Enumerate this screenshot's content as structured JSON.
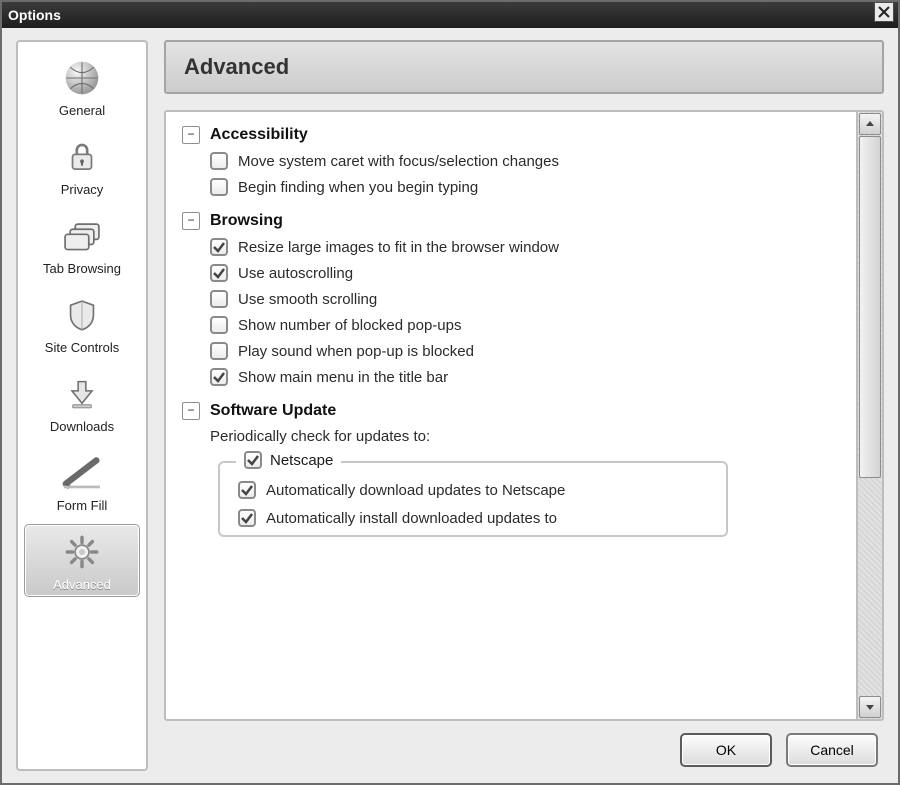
{
  "window": {
    "title": "Options"
  },
  "nav": {
    "items": [
      {
        "label": "General",
        "icon": "globe",
        "selected": false
      },
      {
        "label": "Privacy",
        "icon": "lock",
        "selected": false
      },
      {
        "label": "Tab Browsing",
        "icon": "tabs",
        "selected": false
      },
      {
        "label": "Site Controls",
        "icon": "shield",
        "selected": false
      },
      {
        "label": "Downloads",
        "icon": "download",
        "selected": false
      },
      {
        "label": "Form Fill",
        "icon": "pen",
        "selected": false
      },
      {
        "label": "Advanced",
        "icon": "gear",
        "selected": true
      }
    ]
  },
  "header": {
    "title": "Advanced"
  },
  "sections": {
    "accessibility": {
      "title": "Accessibility",
      "items": [
        {
          "label": "Move system caret with focus/selection changes",
          "checked": false
        },
        {
          "label": "Begin finding when you begin typing",
          "checked": false
        }
      ]
    },
    "browsing": {
      "title": "Browsing",
      "items": [
        {
          "label": "Resize large images to fit in the browser window",
          "checked": true
        },
        {
          "label": "Use autoscrolling",
          "checked": true
        },
        {
          "label": "Use smooth scrolling",
          "checked": false
        },
        {
          "label": "Show number of blocked pop-ups",
          "checked": false
        },
        {
          "label": "Play sound when pop-up is blocked",
          "checked": false
        },
        {
          "label": "Show main menu in the title bar",
          "checked": true
        }
      ]
    },
    "software_update": {
      "title": "Software Update",
      "subtitle": "Periodically check for updates to:",
      "group": {
        "legend_label": "Netscape",
        "legend_checked": true,
        "items": [
          {
            "label": "Automatically download updates to Netscape",
            "checked": true
          },
          {
            "label": "Automatically install downloaded updates to",
            "checked": true
          }
        ]
      }
    }
  },
  "buttons": {
    "ok": "OK",
    "cancel": "Cancel"
  }
}
